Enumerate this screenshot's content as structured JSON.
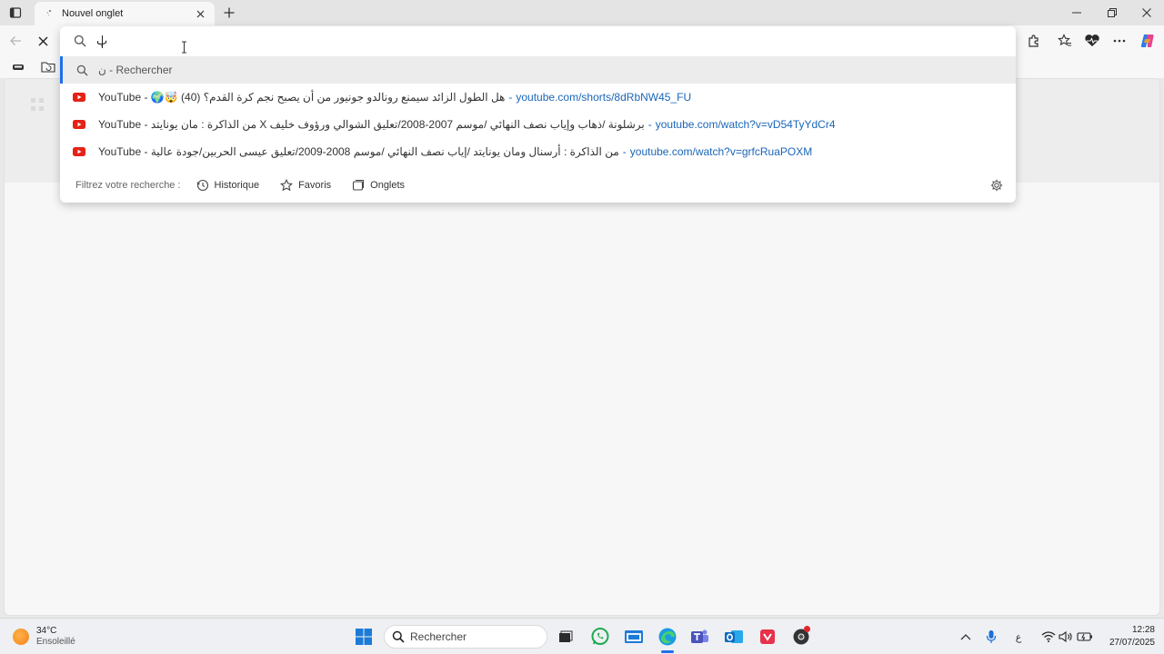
{
  "window": {
    "tab_title": "Nouvel onglet"
  },
  "omnibox": {
    "input_value": "ب",
    "primary_suggestion": "ن - Rechercher",
    "suggestions": [
      {
        "source": "YouTube",
        "title": "YouTube - 🌍🤯 هل الطول الزائد سيمنع رونالدو جونيور من أن يصبح نجم كرة القدم؟ (40)",
        "separator": "-",
        "url": "youtube.com/shorts/8dRbNW45_FU"
      },
      {
        "source": "YouTube",
        "title": "YouTube - من الذاكرة : مان يونايتد X برشلونة /ذهاب وإياب نصف النهائي /موسم 2007-2008/تعليق الشوالي ورؤوف خليف",
        "separator": "-",
        "url": "youtube.com/watch?v=vD54TyYdCr4"
      },
      {
        "source": "YouTube",
        "title": "YouTube - من الذاكرة : أرسنال ومان يونايتد /إياب نصف النهائي /موسم 2008-2009/تعليق عيسى الحربين/جودة عالية",
        "separator": "-",
        "url": "youtube.com/watch?v=grfcRuaPOXM"
      }
    ],
    "filters_label": "Filtrez votre recherche :",
    "filters": [
      {
        "label": "Historique",
        "icon": "history-icon"
      },
      {
        "label": "Favoris",
        "icon": "star-icon"
      },
      {
        "label": "Onglets",
        "icon": "tabs-icon"
      }
    ]
  },
  "taskbar": {
    "weather_temp": "34°C",
    "weather_desc": "Ensoleillé",
    "search_label": "Rechercher",
    "ime_label": "ع",
    "time": "12:28",
    "date": "27/07/2025"
  },
  "colors": {
    "accent": "#1f6feb",
    "youtube_red": "#e62117",
    "url_blue": "#1a66b8"
  }
}
